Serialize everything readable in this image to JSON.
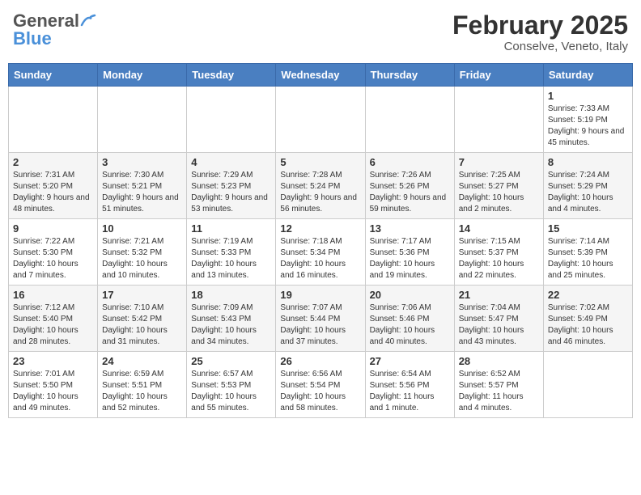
{
  "header": {
    "logo_line1": "General",
    "logo_line2": "Blue",
    "month_title": "February 2025",
    "subtitle": "Conselve, Veneto, Italy"
  },
  "weekdays": [
    "Sunday",
    "Monday",
    "Tuesday",
    "Wednesday",
    "Thursday",
    "Friday",
    "Saturday"
  ],
  "weeks": [
    [
      {
        "day": "",
        "info": ""
      },
      {
        "day": "",
        "info": ""
      },
      {
        "day": "",
        "info": ""
      },
      {
        "day": "",
        "info": ""
      },
      {
        "day": "",
        "info": ""
      },
      {
        "day": "",
        "info": ""
      },
      {
        "day": "1",
        "info": "Sunrise: 7:33 AM\nSunset: 5:19 PM\nDaylight: 9 hours and 45 minutes."
      }
    ],
    [
      {
        "day": "2",
        "info": "Sunrise: 7:31 AM\nSunset: 5:20 PM\nDaylight: 9 hours and 48 minutes."
      },
      {
        "day": "3",
        "info": "Sunrise: 7:30 AM\nSunset: 5:21 PM\nDaylight: 9 hours and 51 minutes."
      },
      {
        "day": "4",
        "info": "Sunrise: 7:29 AM\nSunset: 5:23 PM\nDaylight: 9 hours and 53 minutes."
      },
      {
        "day": "5",
        "info": "Sunrise: 7:28 AM\nSunset: 5:24 PM\nDaylight: 9 hours and 56 minutes."
      },
      {
        "day": "6",
        "info": "Sunrise: 7:26 AM\nSunset: 5:26 PM\nDaylight: 9 hours and 59 minutes."
      },
      {
        "day": "7",
        "info": "Sunrise: 7:25 AM\nSunset: 5:27 PM\nDaylight: 10 hours and 2 minutes."
      },
      {
        "day": "8",
        "info": "Sunrise: 7:24 AM\nSunset: 5:29 PM\nDaylight: 10 hours and 4 minutes."
      }
    ],
    [
      {
        "day": "9",
        "info": "Sunrise: 7:22 AM\nSunset: 5:30 PM\nDaylight: 10 hours and 7 minutes."
      },
      {
        "day": "10",
        "info": "Sunrise: 7:21 AM\nSunset: 5:32 PM\nDaylight: 10 hours and 10 minutes."
      },
      {
        "day": "11",
        "info": "Sunrise: 7:19 AM\nSunset: 5:33 PM\nDaylight: 10 hours and 13 minutes."
      },
      {
        "day": "12",
        "info": "Sunrise: 7:18 AM\nSunset: 5:34 PM\nDaylight: 10 hours and 16 minutes."
      },
      {
        "day": "13",
        "info": "Sunrise: 7:17 AM\nSunset: 5:36 PM\nDaylight: 10 hours and 19 minutes."
      },
      {
        "day": "14",
        "info": "Sunrise: 7:15 AM\nSunset: 5:37 PM\nDaylight: 10 hours and 22 minutes."
      },
      {
        "day": "15",
        "info": "Sunrise: 7:14 AM\nSunset: 5:39 PM\nDaylight: 10 hours and 25 minutes."
      }
    ],
    [
      {
        "day": "16",
        "info": "Sunrise: 7:12 AM\nSunset: 5:40 PM\nDaylight: 10 hours and 28 minutes."
      },
      {
        "day": "17",
        "info": "Sunrise: 7:10 AM\nSunset: 5:42 PM\nDaylight: 10 hours and 31 minutes."
      },
      {
        "day": "18",
        "info": "Sunrise: 7:09 AM\nSunset: 5:43 PM\nDaylight: 10 hours and 34 minutes."
      },
      {
        "day": "19",
        "info": "Sunrise: 7:07 AM\nSunset: 5:44 PM\nDaylight: 10 hours and 37 minutes."
      },
      {
        "day": "20",
        "info": "Sunrise: 7:06 AM\nSunset: 5:46 PM\nDaylight: 10 hours and 40 minutes."
      },
      {
        "day": "21",
        "info": "Sunrise: 7:04 AM\nSunset: 5:47 PM\nDaylight: 10 hours and 43 minutes."
      },
      {
        "day": "22",
        "info": "Sunrise: 7:02 AM\nSunset: 5:49 PM\nDaylight: 10 hours and 46 minutes."
      }
    ],
    [
      {
        "day": "23",
        "info": "Sunrise: 7:01 AM\nSunset: 5:50 PM\nDaylight: 10 hours and 49 minutes."
      },
      {
        "day": "24",
        "info": "Sunrise: 6:59 AM\nSunset: 5:51 PM\nDaylight: 10 hours and 52 minutes."
      },
      {
        "day": "25",
        "info": "Sunrise: 6:57 AM\nSunset: 5:53 PM\nDaylight: 10 hours and 55 minutes."
      },
      {
        "day": "26",
        "info": "Sunrise: 6:56 AM\nSunset: 5:54 PM\nDaylight: 10 hours and 58 minutes."
      },
      {
        "day": "27",
        "info": "Sunrise: 6:54 AM\nSunset: 5:56 PM\nDaylight: 11 hours and 1 minute."
      },
      {
        "day": "28",
        "info": "Sunrise: 6:52 AM\nSunset: 5:57 PM\nDaylight: 11 hours and 4 minutes."
      },
      {
        "day": "",
        "info": ""
      }
    ]
  ]
}
